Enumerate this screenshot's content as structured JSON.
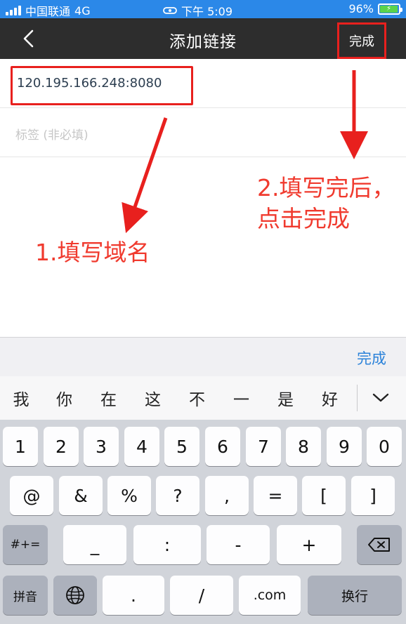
{
  "status_bar": {
    "carrier": "中国联通",
    "network": "4G",
    "time": "下午 5:09",
    "battery": "96%"
  },
  "nav": {
    "title": "添加链接",
    "done_label": "完成"
  },
  "form": {
    "link_value": "120.195.166.248:8080",
    "tag_placeholder": "标签 (非必填)"
  },
  "annotations": {
    "step1": "1.填写域名",
    "step2": "2.填写完后，点击完成"
  },
  "keyboard": {
    "accessory_done": "完成",
    "candidates": [
      "我",
      "你",
      "在",
      "这",
      "不",
      "一",
      "是",
      "好"
    ],
    "row1": [
      "1",
      "2",
      "3",
      "4",
      "5",
      "6",
      "7",
      "8",
      "9",
      "0"
    ],
    "row2": [
      "@",
      "&",
      "%",
      "?",
      ",",
      "=",
      "[",
      "]"
    ],
    "row3_left": "#+=",
    "row3": [
      "_",
      ":",
      "-",
      "+"
    ],
    "row4": {
      "pinyin": "拼音",
      "dot": ".",
      "slash": "/",
      "dotcom": ".com",
      "newline": "换行"
    }
  },
  "colors": {
    "status_bar": "#2b88e8",
    "nav_bar": "#2d2d2d",
    "annotation_red": "#e8201e",
    "accent_blue": "#2b82d9",
    "battery_green": "#5ad34b"
  }
}
